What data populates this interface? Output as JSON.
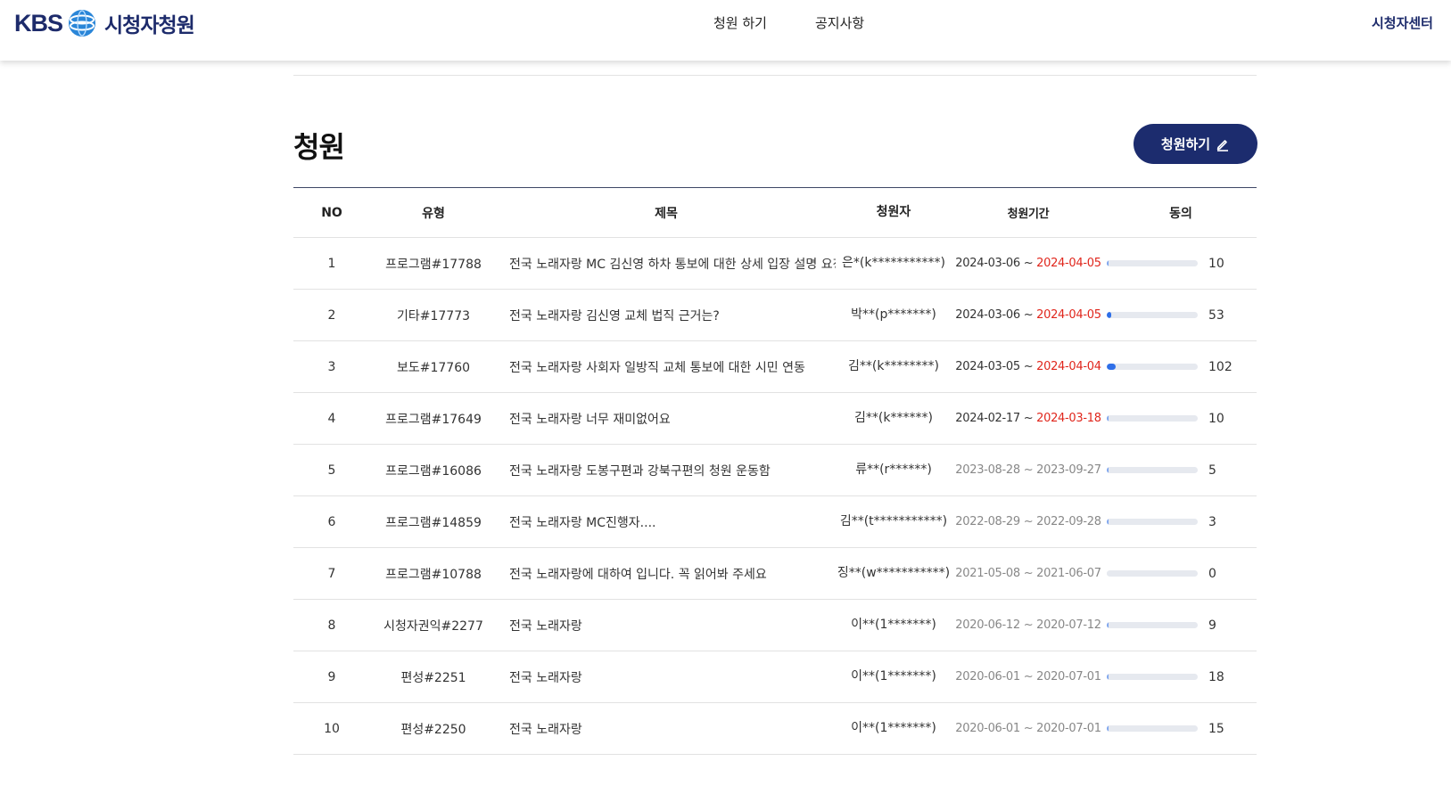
{
  "header": {
    "brand": "KBS",
    "site_name": "시청자청원",
    "nav": [
      "청원 하기",
      "공지사항"
    ],
    "center_link": "시청자센터"
  },
  "page": {
    "title": "청원",
    "petition_button": "청원하기"
  },
  "colors": {
    "brand": "#1c2c6e",
    "active_end_date": "#e0261c",
    "progress": "#2f6fe8"
  },
  "table": {
    "headers": {
      "no": "NO",
      "type": "유형",
      "title": "제목",
      "author": "청원자",
      "period": "청원기간",
      "agree": "동의"
    },
    "rows": [
      {
        "no": "1",
        "type": "프로그램#17788",
        "title": "전국 노래자랑 MC 김신영 하차 통보에 대한 상세 입장 설명 요청",
        "author": "은*(k***********)",
        "start": "2024-03-06",
        "end": "2024-04-05",
        "active": true,
        "agree": "10",
        "progress": 0.01
      },
      {
        "no": "2",
        "type": "기타#17773",
        "title": "전국 노래자랑 김신영 교체 법직 근거는?",
        "author": "박**(p*******)",
        "start": "2024-03-06",
        "end": "2024-04-05",
        "active": true,
        "agree": "53",
        "progress": 0.05
      },
      {
        "no": "3",
        "type": "보도#17760",
        "title": "전국 노래자랑 사회자 일방직 교체 통보에 대한 시민 연동",
        "author": "김**(k********)",
        "start": "2024-03-05",
        "end": "2024-04-04",
        "active": true,
        "agree": "102",
        "progress": 0.1
      },
      {
        "no": "4",
        "type": "프로그램#17649",
        "title": "전국 노래자랑 너무 재미없어요",
        "author": "김**(k******)",
        "start": "2024-02-17",
        "end": "2024-03-18",
        "active": true,
        "agree": "10",
        "progress": 0.01
      },
      {
        "no": "5",
        "type": "프로그램#16086",
        "title": "전국 노래자랑 도봉구편과 강북구편의 청원 운동함",
        "author": "류**(r******)",
        "start": "2023-08-28",
        "end": "2023-09-27",
        "active": false,
        "agree": "5",
        "progress": 0.005
      },
      {
        "no": "6",
        "type": "프로그램#14859",
        "title": "전국 노래자랑 MC진행자....",
        "author": "김**(t***********)",
        "start": "2022-08-29",
        "end": "2022-09-28",
        "active": false,
        "agree": "3",
        "progress": 0.003
      },
      {
        "no": "7",
        "type": "프로그램#10788",
        "title": "전국 노래자랑에 대하여 입니다. 꼭 읽어봐 주세요",
        "author": "징**(w***********)",
        "start": "2021-05-08",
        "end": "2021-06-07",
        "active": false,
        "agree": "0",
        "progress": 0
      },
      {
        "no": "8",
        "type": "시청자권익#2277",
        "title": "전국 노래자랑",
        "author": "이**(1*******)",
        "start": "2020-06-12",
        "end": "2020-07-12",
        "active": false,
        "agree": "9",
        "progress": 0.009
      },
      {
        "no": "9",
        "type": "편성#2251",
        "title": "전국 노래자랑",
        "author": "이**(1*******)",
        "start": "2020-06-01",
        "end": "2020-07-01",
        "active": false,
        "agree": "18",
        "progress": 0.018
      },
      {
        "no": "10",
        "type": "편성#2250",
        "title": "전국 노래자랑",
        "author": "이**(1*******)",
        "start": "2020-06-01",
        "end": "2020-07-01",
        "active": false,
        "agree": "15",
        "progress": 0.015
      }
    ]
  }
}
